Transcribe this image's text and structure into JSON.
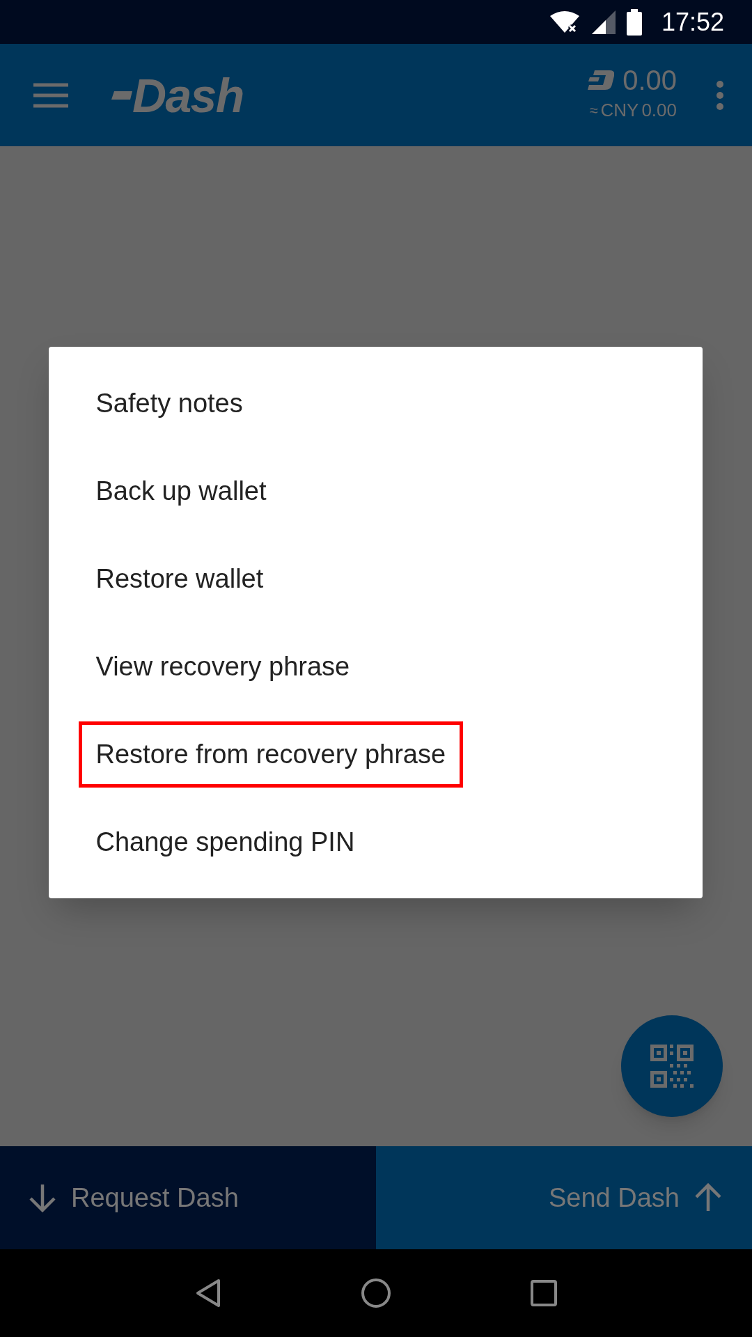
{
  "status_bar": {
    "time": "17:52"
  },
  "toolbar": {
    "logo": "Dash",
    "balance": "0.00",
    "fiat_prefix": "≈",
    "fiat_currency": "CNY",
    "fiat_amount": "0.00"
  },
  "menu": {
    "items": [
      {
        "label": "Safety notes",
        "highlighted": false
      },
      {
        "label": "Back up wallet",
        "highlighted": false
      },
      {
        "label": "Restore wallet",
        "highlighted": false
      },
      {
        "label": "View recovery phrase",
        "highlighted": false
      },
      {
        "label": "Restore from recovery phrase",
        "highlighted": true
      },
      {
        "label": "Change spending PIN",
        "highlighted": false
      }
    ]
  },
  "bottom_bar": {
    "request": "Request Dash",
    "send": "Send Dash"
  }
}
